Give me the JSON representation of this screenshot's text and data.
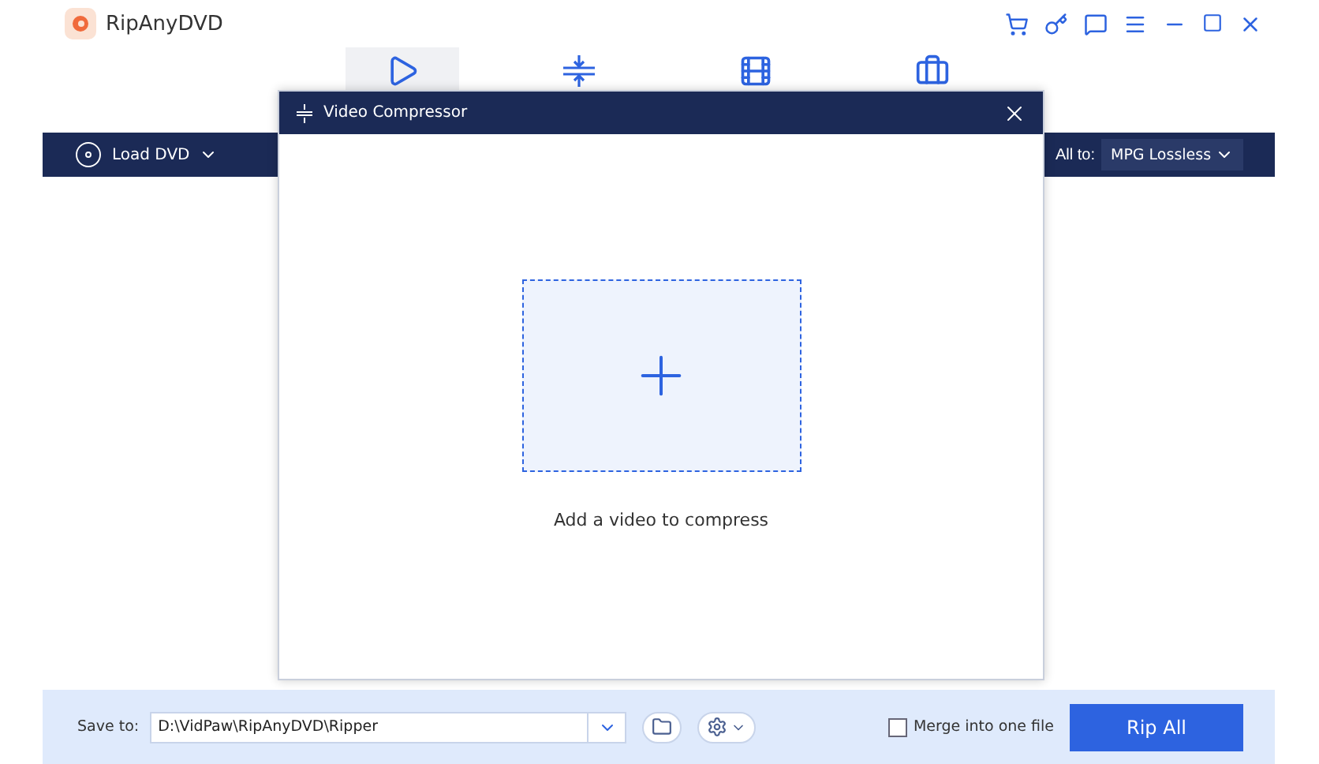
{
  "app": {
    "name": "RipAnyDVD"
  },
  "tabs": [
    {
      "kind": "ripper",
      "selected": true
    },
    {
      "kind": "compressor",
      "selected": false
    },
    {
      "kind": "maker",
      "selected": false
    },
    {
      "kind": "toolbox",
      "selected": false
    }
  ],
  "toolbar": {
    "load_label": "Load DVD",
    "convert_label": "All to:",
    "format": "MPG Lossless"
  },
  "dialog": {
    "title": "Video Compressor",
    "drop_hint": "Add a video to compress"
  },
  "bottom_bar": {
    "save_label": "Save to:",
    "path": "D:\\VidPaw\\RipAnyDVD\\Ripper",
    "merge_label": "Merge into one file",
    "merge_checked": false,
    "rip_button": "Rip All"
  }
}
